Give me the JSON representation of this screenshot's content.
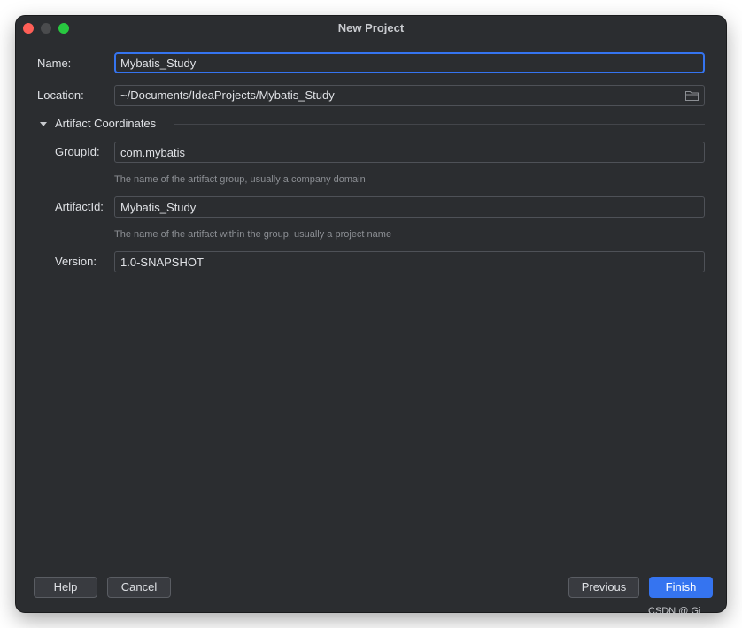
{
  "window": {
    "title": "New Project"
  },
  "form": {
    "name_label": "Name:",
    "name_value": "Mybatis_Study",
    "location_label": "Location:",
    "location_value": "~/Documents/IdeaProjects/Mybatis_Study"
  },
  "artifact": {
    "section_title": "Artifact Coordinates",
    "group_label": "GroupId:",
    "group_value": "com.mybatis",
    "group_hint": "The name of the artifact group, usually a company domain",
    "artifact_label": "ArtifactId:",
    "artifact_value": "Mybatis_Study",
    "artifact_hint": "The name of the artifact within the group, usually a project name",
    "version_label": "Version:",
    "version_value": "1.0-SNAPSHOT"
  },
  "buttons": {
    "help": "Help",
    "cancel": "Cancel",
    "previous": "Previous",
    "finish": "Finish"
  },
  "watermark": "CSDN @ Gi",
  "icons": {
    "location_browse": "folder-icon",
    "section_toggle": "triangle-down-icon"
  },
  "colors": {
    "background": "#2b2d30",
    "accent": "#3574f0",
    "close": "#ff5f57",
    "maximize": "#28c840"
  }
}
